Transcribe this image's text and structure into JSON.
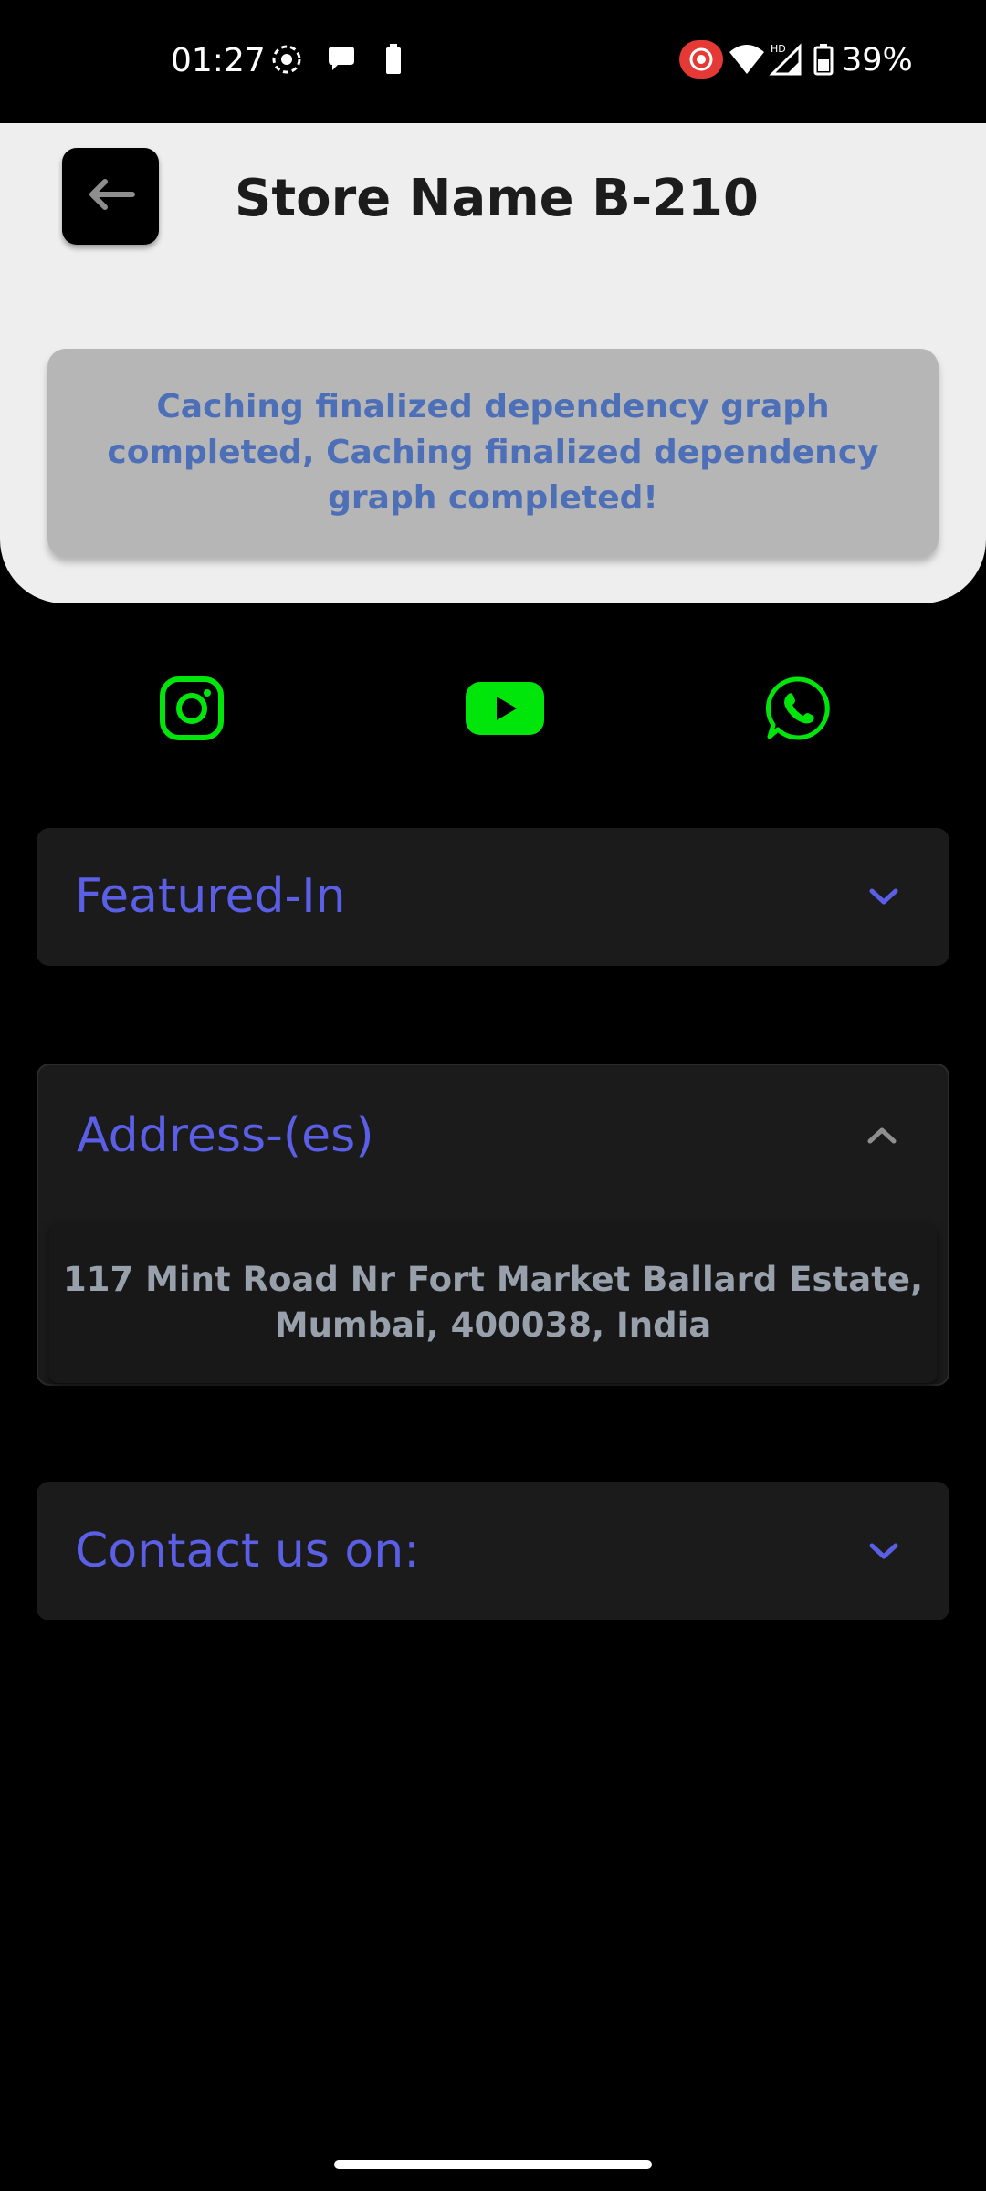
{
  "status_bar": {
    "time": "01:27",
    "battery_percent": "39%",
    "icons_left": [
      "screen-record-icon",
      "chat-bubble-icon",
      "battery-saver-icon"
    ],
    "icons_right": [
      "recording-indicator-icon",
      "wifi-icon",
      "signal-hd-icon",
      "battery-icon"
    ]
  },
  "header": {
    "title": "Store Name B-210",
    "back_icon": "arrow-left-icon",
    "message": "Caching finalized dependency graph completed, Caching finalized dependency graph completed!"
  },
  "social": [
    {
      "name": "instagram-icon",
      "color": "#00e60b"
    },
    {
      "name": "youtube-icon",
      "color": "#00e60b"
    },
    {
      "name": "whatsapp-icon",
      "color": "#00e60b"
    }
  ],
  "accordions": {
    "featured": {
      "title": "Featured-In",
      "expanded": false
    },
    "address": {
      "title": "Address-(es)",
      "expanded": true,
      "content": "117  Mint Road Nr Fort Market Ballard Estate,\nMumbai, 400038, India"
    },
    "contact": {
      "title": "Contact us on:",
      "expanded": false
    }
  },
  "colors": {
    "accent": "#5a5fe6",
    "social_green": "#00e60b",
    "header_bg": "#eeeeee",
    "message_bg": "#b6b6b6",
    "message_text": "#4d6fb8",
    "card_bg": "#1b1b1c"
  }
}
